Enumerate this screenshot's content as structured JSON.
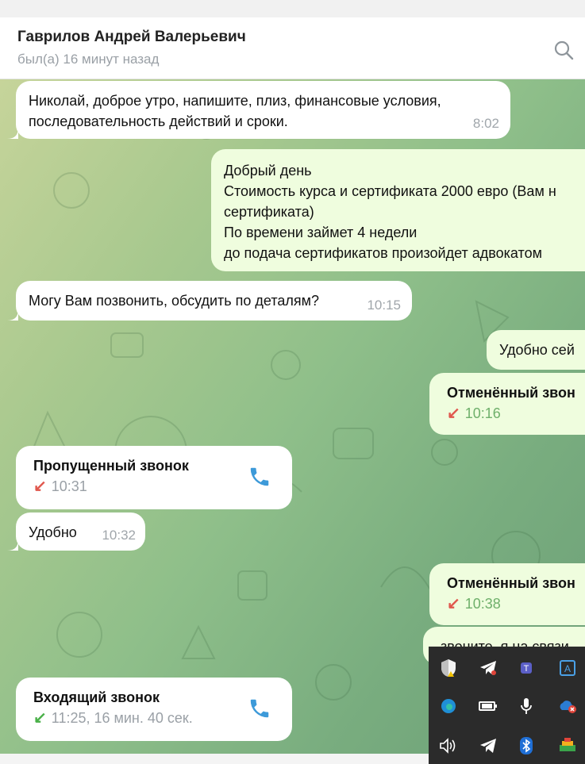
{
  "header": {
    "contact_name": "Гаврилов Андрей Валерьевич",
    "status": "был(а) 16 минут назад"
  },
  "messages": [
    {
      "text_line1": "Николай, доброе утро, напишите, плиз, финансовые условия,",
      "text_line2": "последовательность действий и сроки.",
      "time": "8:02"
    },
    {
      "lines": [
        "Добрый день",
        "Стоимость курса и сертификата 2000 евро (Вам н",
        "сертификата)",
        "По времени займет 4 недели",
        "до подача сертификатов произойдет адвокатом"
      ]
    },
    {
      "text": "Могу Вам позвонить, обсудить по деталям?",
      "time": "10:15"
    },
    {
      "text": "Удобно сей"
    },
    {
      "title": "Отменённый звон",
      "time": "10:16"
    },
    {
      "title": "Пропущенный звонок",
      "time": "10:31"
    },
    {
      "text": "Удобно",
      "time": "10:32"
    },
    {
      "title": "Отменённый звон",
      "time": "10:38"
    },
    {
      "text": "звоните, я на связи"
    },
    {
      "title": "Входящий звонок",
      "time": "11:25, 16 мин. 40 сек."
    }
  ],
  "icons": {
    "search": "search-icon",
    "phone": "phone-icon",
    "arrow_out": "↙",
    "arrow_in": "↙"
  },
  "colors": {
    "accent": "#3d9ad9",
    "outgoing_bubble": "#effdde",
    "missed_red": "#e0574d",
    "incoming_green": "#49b048"
  }
}
